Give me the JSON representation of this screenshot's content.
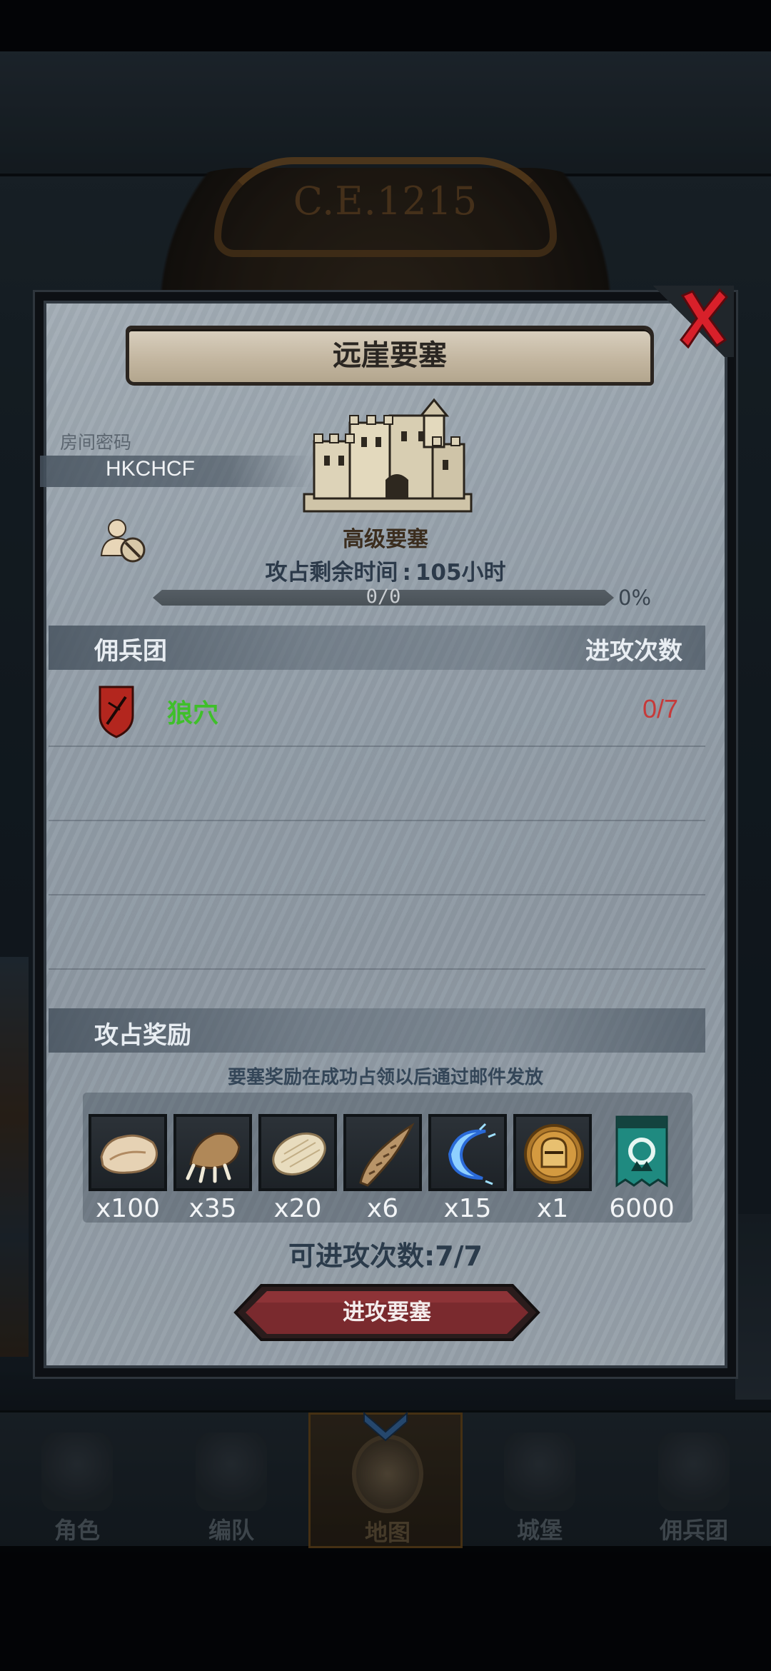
{
  "scene": {
    "era": "C.E.1215"
  },
  "bottom_nav": {
    "tabs": [
      {
        "label": "角色",
        "icon": "character-icon"
      },
      {
        "label": "编队",
        "icon": "formation-icon"
      },
      {
        "label": "地图",
        "icon": "map-icon",
        "active": true
      },
      {
        "label": "城堡",
        "icon": "castle-icon"
      },
      {
        "label": "佣兵团",
        "icon": "mercenary-icon"
      }
    ]
  },
  "modal": {
    "title": "远崖要塞",
    "room_code_label": "房间密码",
    "room_code": "HKCHCF",
    "fortress_grade": "高级要塞",
    "siege_time_label": "攻占剩余时间",
    "siege_time_value": "105小时",
    "progress_text": "0/0",
    "progress_percent": "0%",
    "progress_fraction": 0,
    "mercenary_header": "佣兵团",
    "attack_count_header": "进攻次数",
    "mercenaries": [
      {
        "name": "狼穴",
        "attacks": "0/7"
      }
    ],
    "reward_header": "攻占奖励",
    "reward_note": "要塞奖励在成功占领以后通过邮件发放",
    "rewards": [
      {
        "icon": "fur-pelt-icon",
        "count": "x100"
      },
      {
        "icon": "beast-claw-icon",
        "count": "x35"
      },
      {
        "icon": "hide-leather-icon",
        "count": "x20"
      },
      {
        "icon": "horn-icon",
        "count": "x6"
      },
      {
        "icon": "crescent-essence-icon",
        "count": "x15"
      },
      {
        "icon": "knight-helmet-medal-icon",
        "count": "x1"
      },
      {
        "icon": "guild-banner-icon",
        "count": "6000"
      }
    ],
    "attempts_label": "可进攻次数",
    "attempts_value": "7/7",
    "attack_button": "进攻要塞"
  },
  "colors": {
    "guild_name": "#3fbf2a",
    "attacks_used": "#c63a3a",
    "close": "#d8202a",
    "attack_button": "#7a2a2e"
  }
}
